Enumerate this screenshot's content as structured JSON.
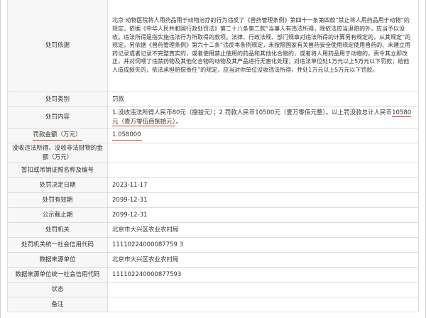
{
  "rows": [
    {
      "label": "处罚依据",
      "value": "北京            动物医院将人用药品用于动物治疗的行为违反了《兽药管理条例》第四十一条第四款“禁止将人用药品用于动物”的规定，依据《中华人民共和国行政处罚法》第二十八条第二款“当事人有违法所得，除依法应当退赔的外，应当予以没收。违法所得是指实施违法行为所取得的款项。法律、行政法规、部门规章对违法所得的计算另有规定的，从其规定”的规定，另依据《兽药管理条例》第六十二条“违反本条例规定，未按照国家有关兽药安全使用规定使用兽药的、未建立用药记录或者记录不完整真实的，或者使用禁止使用的药品和其他化合物的，或者将人用药品用于动物的，责令其立即改正，并对饲喂了违禁药物及其他化合物的动物及其产品进行无害化处理；对违法单位处1万元以上5万元以下罚款；给他人造成损失的，依法承担赔偿责任”的规定，应当对你单位没收违法所得，并处1万元以上5万元以下罚款。"
    },
    {
      "label": "处罚类别",
      "value": "罚款"
    },
    {
      "label": "处罚内容",
      "value_pre": "1.没收违法所得人民币80元（捌拾元）；2.罚款人民币10500元（壹万零佰元整）。以上罚没款总计人民币",
      "value_hl": "10580元（壹万零伍佰捌拾元）",
      "value_post": "。"
    },
    {
      "label": "罚款金额（万元）",
      "value": "1.058000"
    },
    {
      "label": "没收违法所得、没收非法财物的金额（万元）",
      "value": ""
    },
    {
      "label": "暂扣或吊销证照名称及编号",
      "value": ""
    },
    {
      "label": "处罚决定日期",
      "value": "2023-11-17"
    },
    {
      "label": "处罚有效期",
      "value": "2099-12-31"
    },
    {
      "label": "公示截止期",
      "value": "2099-12-31"
    },
    {
      "label": "处罚机关",
      "value": "北京市大兴区农业农村局"
    },
    {
      "label": "处罚机关统一社会信用代码",
      "value": "11110224000087759 3"
    },
    {
      "label": "数据来源单位",
      "value": "北京市大兴区农业农村局"
    },
    {
      "label": "数据来源单位统一社会信用代码",
      "value": "111102240000877593"
    },
    {
      "label": "状态",
      "value": ""
    },
    {
      "label": "备注",
      "value": ""
    }
  ]
}
